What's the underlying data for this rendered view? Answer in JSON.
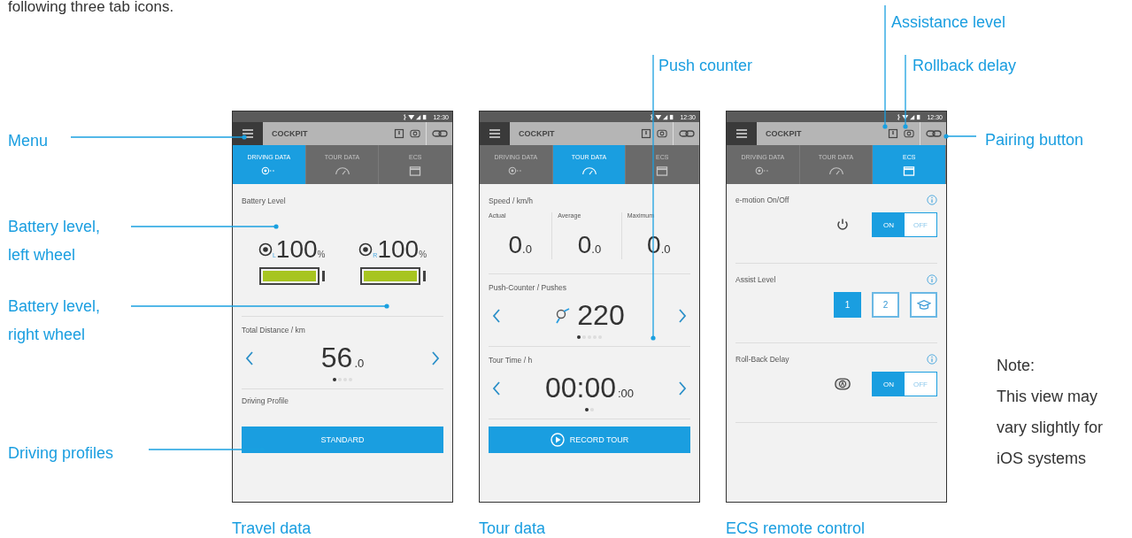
{
  "intro_text": "following three tab icons.",
  "callouts": [
    {
      "label": "Menu"
    },
    {
      "label": "Battery level, left wheel"
    },
    {
      "label": "Battery level, right wheel"
    },
    {
      "label": "Driving profiles"
    },
    {
      "label": "Push counter"
    },
    {
      "label": "Assistance level"
    },
    {
      "label": "Rollback delay"
    },
    {
      "label": "Pairing button"
    }
  ],
  "note": "Note:\nThis view may\nvary slightly for\niOS systems",
  "screens": [
    {
      "status_time": "12:30",
      "app_title": "COCKPIT",
      "caption": "Travel data",
      "tabs": [
        {
          "label": "DRIVING DATA",
          "selected": true
        },
        {
          "label": "TOUR DATA",
          "selected": false
        },
        {
          "label": "ECS",
          "selected": false
        }
      ],
      "sections": [
        {
          "kind": "battery",
          "title": "Battery Level",
          "batteries": [
            {
              "side": "L",
              "reading": "100",
              "unit": "%",
              "level": 1
            },
            {
              "side": "R",
              "reading": "100",
              "unit": "%",
              "level": 1
            }
          ]
        },
        {
          "kind": "carousel",
          "title": "Total Distance / km",
          "value": "56",
          "decimal": ".0",
          "dots": [
            {
              "selected": true
            },
            {
              "selected": false
            },
            {
              "selected": false
            },
            {
              "selected": false
            }
          ]
        },
        {
          "kind": "button",
          "title": "Driving Profile",
          "label": "STANDARD"
        }
      ]
    },
    {
      "status_time": "12:30",
      "app_title": "COCKPIT",
      "caption": "Tour data",
      "tabs": [
        {
          "label": "DRIVING DATA",
          "selected": false
        },
        {
          "label": "TOUR DATA",
          "selected": true
        },
        {
          "label": "ECS",
          "selected": false
        }
      ],
      "sections": [
        {
          "kind": "speed",
          "title": "Speed / km/h",
          "columns": [
            {
              "label": "Actual",
              "value": "0",
              "decimal": ".0"
            },
            {
              "label": "Average",
              "value": "0",
              "decimal": ".0"
            },
            {
              "label": "Maximum",
              "value": "0",
              "decimal": ".0"
            }
          ]
        },
        {
          "kind": "counter",
          "title": "Push-Counter / Pushes",
          "value": "220",
          "dots": [
            {
              "selected": true
            },
            {
              "selected": false
            },
            {
              "selected": false
            },
            {
              "selected": false
            },
            {
              "selected": false
            }
          ]
        },
        {
          "kind": "carousel",
          "title": "Tour Time / h",
          "value": "00:00",
          "decimal": ":00",
          "dots": [
            {
              "selected": true
            },
            {
              "selected": false
            }
          ]
        },
        {
          "kind": "record_button",
          "label": "RECORD TOUR"
        }
      ]
    },
    {
      "status_time": "12:30",
      "app_title": "COCKPIT",
      "caption": "ECS remote control",
      "tabs": [
        {
          "label": "DRIVING DATA",
          "selected": false
        },
        {
          "label": "TOUR DATA",
          "selected": false
        },
        {
          "label": "ECS",
          "selected": true
        }
      ],
      "sections": [
        {
          "kind": "toggle",
          "title": "e-motion On/Off",
          "options": [
            {
              "label": "ON",
              "selected": true
            },
            {
              "label": "OFF",
              "selected": false
            }
          ]
        },
        {
          "kind": "choice",
          "title": "Assist Level",
          "options": [
            {
              "kind": "text",
              "label": "1",
              "selected": true
            },
            {
              "kind": "text",
              "label": "2",
              "selected": false
            },
            {
              "kind": "icon",
              "selected": false
            }
          ]
        },
        {
          "kind": "toggle",
          "title": "Roll-Back Delay",
          "options": [
            {
              "label": "ON",
              "selected": true
            },
            {
              "label": "OFF",
              "selected": false
            }
          ]
        }
      ]
    }
  ]
}
